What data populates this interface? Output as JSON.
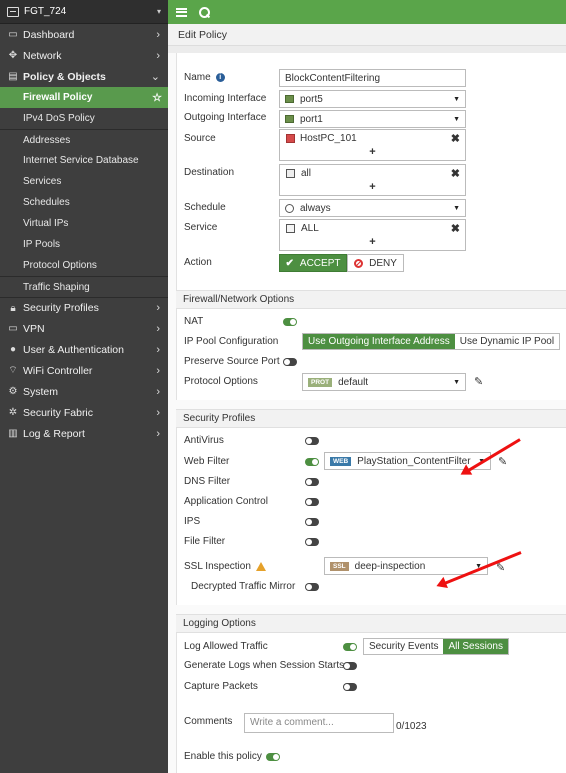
{
  "device": {
    "name": "FGT_724"
  },
  "sidebar": {
    "items": [
      {
        "label": "Dashboard",
        "icon": "dashboard-icon"
      },
      {
        "label": "Network",
        "icon": "network-icon"
      },
      {
        "label": "Policy & Objects",
        "icon": "policy-icon"
      }
    ],
    "policy_sub": [
      {
        "label": "Firewall Policy",
        "active": true
      },
      {
        "label": "IPv4 DoS Policy"
      },
      {
        "label": "Addresses"
      },
      {
        "label": "Internet Service Database"
      },
      {
        "label": "Services"
      },
      {
        "label": "Schedules"
      },
      {
        "label": "Virtual IPs"
      },
      {
        "label": "IP Pools"
      },
      {
        "label": "Protocol Options"
      },
      {
        "label": "Traffic Shaping"
      }
    ],
    "more": [
      {
        "label": "Security Profiles",
        "icon": "lock-icon"
      },
      {
        "label": "VPN",
        "icon": "monitor-icon"
      },
      {
        "label": "User & Authentication",
        "icon": "user-icon"
      },
      {
        "label": "WiFi Controller",
        "icon": "wifi-icon"
      },
      {
        "label": "System",
        "icon": "gear-icon"
      },
      {
        "label": "Security Fabric",
        "icon": "fabric-icon"
      },
      {
        "label": "Log & Report",
        "icon": "chart-icon"
      }
    ]
  },
  "page": {
    "title": "Edit Policy"
  },
  "form": {
    "name_label": "Name",
    "name_value": "BlockContentFiltering",
    "incoming_label": "Incoming Interface",
    "incoming_value": "port5",
    "outgoing_label": "Outgoing Interface",
    "outgoing_value": "port1",
    "source_label": "Source",
    "source_value": "HostPC_101",
    "destination_label": "Destination",
    "destination_value": "all",
    "schedule_label": "Schedule",
    "schedule_value": "always",
    "service_label": "Service",
    "service_value": "ALL",
    "action_label": "Action",
    "accept_label": "ACCEPT",
    "deny_label": "DENY"
  },
  "fw_options": {
    "header": "Firewall/Network Options",
    "nat_label": "NAT",
    "ippool_label": "IP Pool Configuration",
    "ippool_opt1": "Use Outgoing Interface Address",
    "ippool_opt2": "Use Dynamic IP Pool",
    "preserve_label": "Preserve Source Port",
    "protocol_label": "Protocol Options",
    "protocol_tag": "PROT",
    "protocol_value": "default"
  },
  "sec_profiles": {
    "header": "Security Profiles",
    "antivirus": "AntiVirus",
    "webfilter": "Web Filter",
    "webfilter_tag": "WEB",
    "webfilter_value": "PlayStation_ContentFilter",
    "dnsfilter": "DNS Filter",
    "appcontrol": "Application Control",
    "ips": "IPS",
    "filefilter": "File Filter",
    "ssl_label": "SSL Inspection",
    "ssl_tag": "SSL",
    "ssl_value": "deep-inspection",
    "decrypted_label": "Decrypted Traffic Mirror"
  },
  "logging": {
    "header": "Logging Options",
    "log_allowed": "Log Allowed Traffic",
    "opt1": "Security Events",
    "opt2": "All Sessions",
    "gen_logs": "Generate Logs when Session Starts",
    "capture": "Capture Packets"
  },
  "comments": {
    "label": "Comments",
    "placeholder": "Write a comment...",
    "counter": "0/1023"
  },
  "enable": {
    "label": "Enable this policy"
  },
  "colors": {
    "brand_green": "#5aa54a",
    "accent_green": "#4d8f41",
    "sidebar_bg": "#3e3e3e",
    "arrow_red": "#e11111"
  }
}
